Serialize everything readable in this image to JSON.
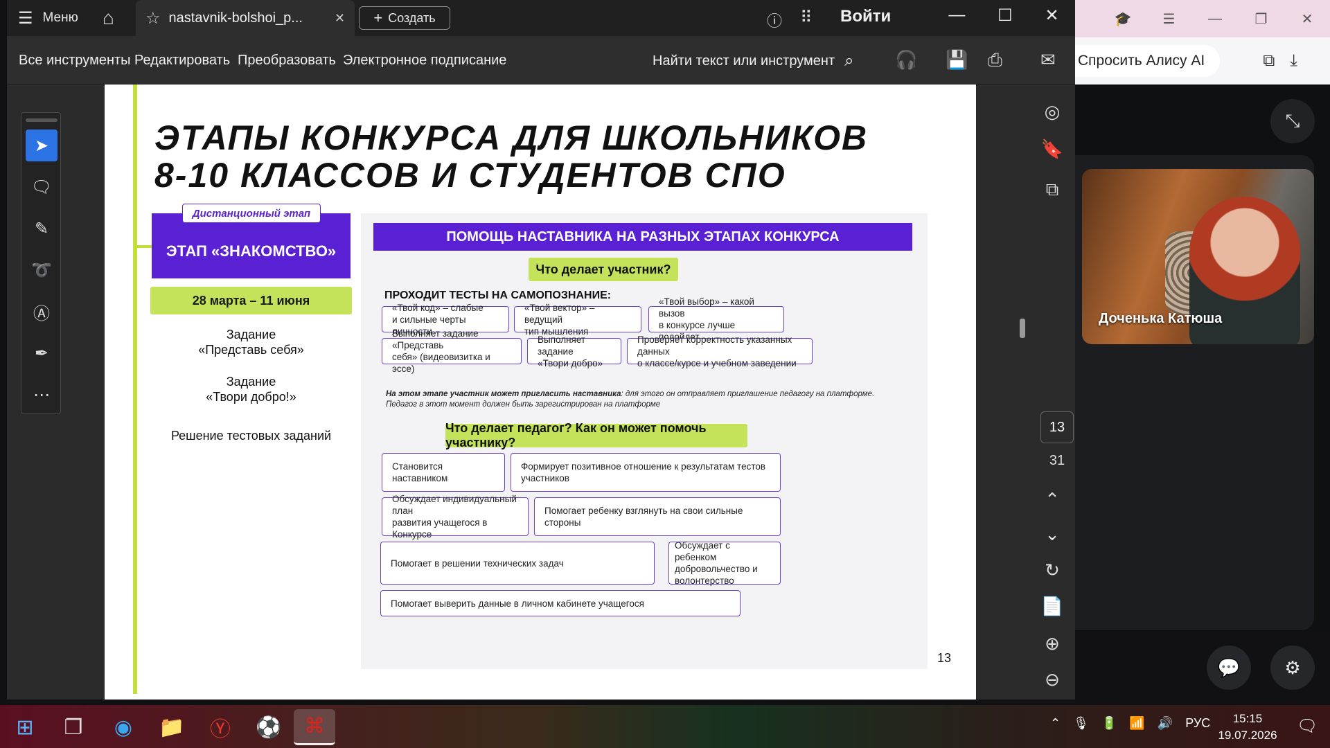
{
  "acrobat": {
    "menu_label": "Меню",
    "tab_title": "nastavnik-bolshoi_p...",
    "create_label": "Создать",
    "login_label": "Войти",
    "tools": [
      "Все инструменты",
      "Редактировать",
      "Преобразовать",
      "Электронное подписание"
    ],
    "search_tools_label": "Найти текст или инструмент",
    "current_page": "13",
    "total_pages": "31"
  },
  "browser": {
    "alice_label": "Спросить Алису AI",
    "video_name": "Доченька Катюша"
  },
  "pdf": {
    "title_line1": "Этапы конкурса для школьников",
    "title_line2": "8-10 классов и студентов СПО",
    "stage_tag": "Дистанционный этап",
    "stage_name": "ЭТАП «ЗНАКОМСТВО»",
    "dates": "28 марта – 11 июня",
    "task1_line1": "Задание",
    "task1_line2": "«Представь себя»",
    "task2_line1": "Задание",
    "task2_line2": "«Твори добро!»",
    "task3": "Решение тестовых заданий",
    "panel_header": "ПОМОЩЬ НАСТАВНИКА НА РАЗНЫХ ЭТАПАХ КОНКУРСА",
    "q_participant": "Что делает участник?",
    "tests_label": "ПРОХОДИТ ТЕСТЫ НА САМОПОЗНАНИЕ:",
    "participant_boxes": [
      {
        "l1": "«Твой код» – слабые",
        "l2": "и сильные черты личности"
      },
      {
        "l1": "«Твой вектор» – ведущий",
        "l2": "тип мышления"
      },
      {
        "l1": "«Твой выбор» – какой вызов",
        "l2": "в конкурсе лучше подойдет"
      },
      {
        "l1": "Выполняет задание «Представь",
        "l2": "себя» (видеовизитка и эссе)"
      },
      {
        "l1": "Выполняет задание",
        "l2": "«Твори добро»"
      },
      {
        "l1": "Проверяет корректность указанных данных",
        "l2": "о классе/курсе и учебном заведении"
      }
    ],
    "note_bold": "На этом этапе участник может пригласить наставника",
    "note_rest": ": для этого он отправляет приглашение педагогу на платформе.",
    "note_line2": "Педагог в этот момент должен быть зарегистрирован на платформе",
    "q_teacher": "Что делает педагог? Как он может помочь участнику?",
    "teacher_boxes": [
      {
        "l1": "Становится наставником",
        "l2": ""
      },
      {
        "l1": "Формирует позитивное отношение к результатам тестов участников",
        "l2": ""
      },
      {
        "l1": "Обсуждает индивидуальный план",
        "l2": "развития учащегося в Конкурсе"
      },
      {
        "l1": "Помогает ребенку взглянуть на свои сильные стороны",
        "l2": ""
      },
      {
        "l1": "Помогает в решении технических задач",
        "l2": ""
      },
      {
        "l1": "Обсуждает с ребенком",
        "l2": "добровольчество и",
        "l3": "волонтерство"
      },
      {
        "l1": "Помогает выверить данные в личном кабинете учащегося",
        "l2": ""
      }
    ],
    "page_number": "13"
  },
  "taskbar": {
    "lang": "РУС",
    "time": "15:15",
    "date": "19.07.2026"
  },
  "colors": {
    "purple": "#5a21d4",
    "lime": "#c4e35a",
    "acrobat_dark": "#2e2e2e"
  }
}
